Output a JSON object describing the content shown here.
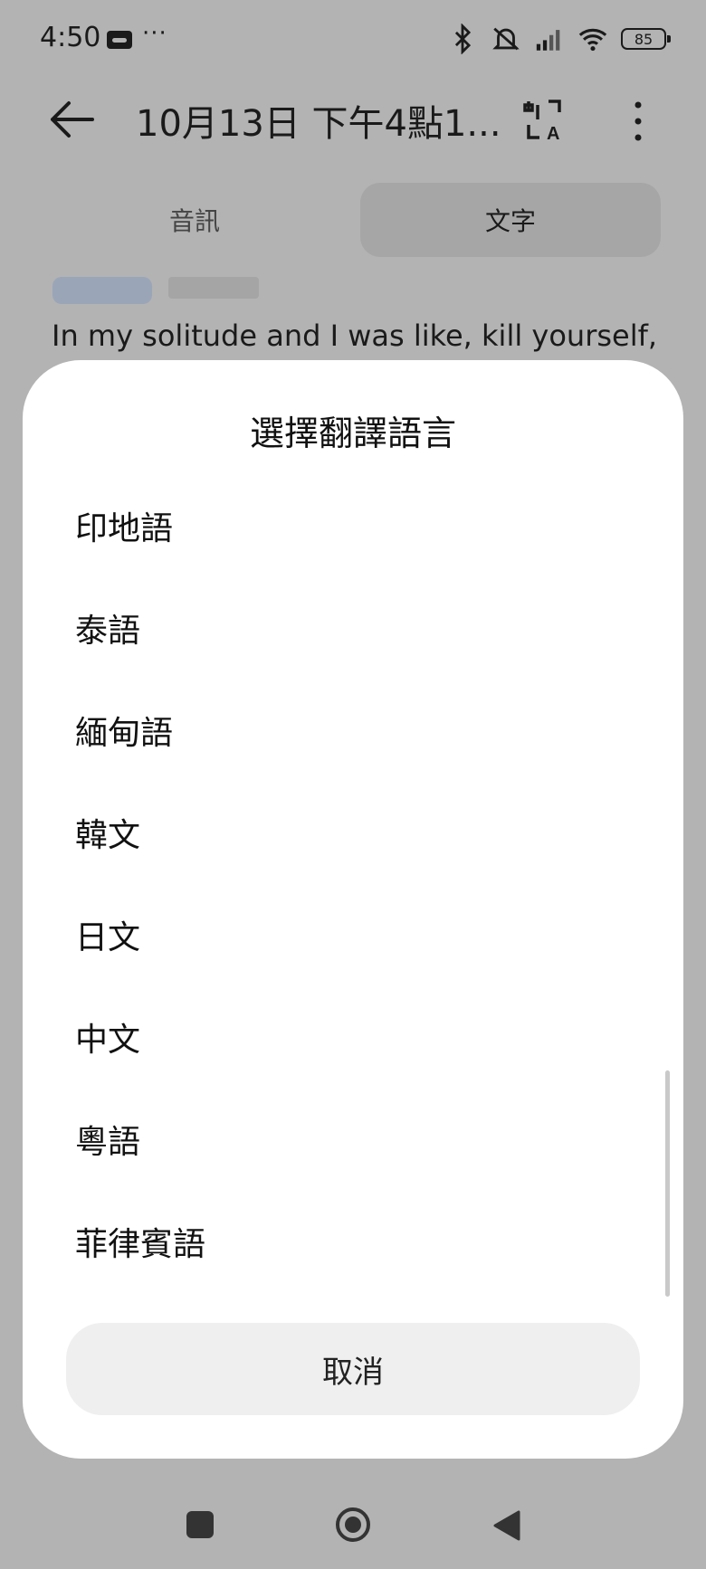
{
  "status_bar": {
    "time": "4:50",
    "more": "···",
    "battery": "85"
  },
  "app_bar": {
    "title": "10月13日 下午4點1..."
  },
  "tabs": [
    {
      "label": "音訊",
      "selected": false
    },
    {
      "label": "文字",
      "selected": true
    }
  ],
  "transcript": {
    "line": "In my solitude and I was like, kill yourself,"
  },
  "sheet": {
    "title": "選擇翻譯語言",
    "languages": [
      "印地語",
      "泰語",
      "緬甸語",
      "韓文",
      "日文",
      "中文",
      "粵語",
      "菲律賓語"
    ],
    "cancel_label": "取消"
  },
  "colors": {
    "scrim_background": "#b3b3b3",
    "sheet_background": "#ffffff",
    "cancel_background": "#efefef"
  }
}
